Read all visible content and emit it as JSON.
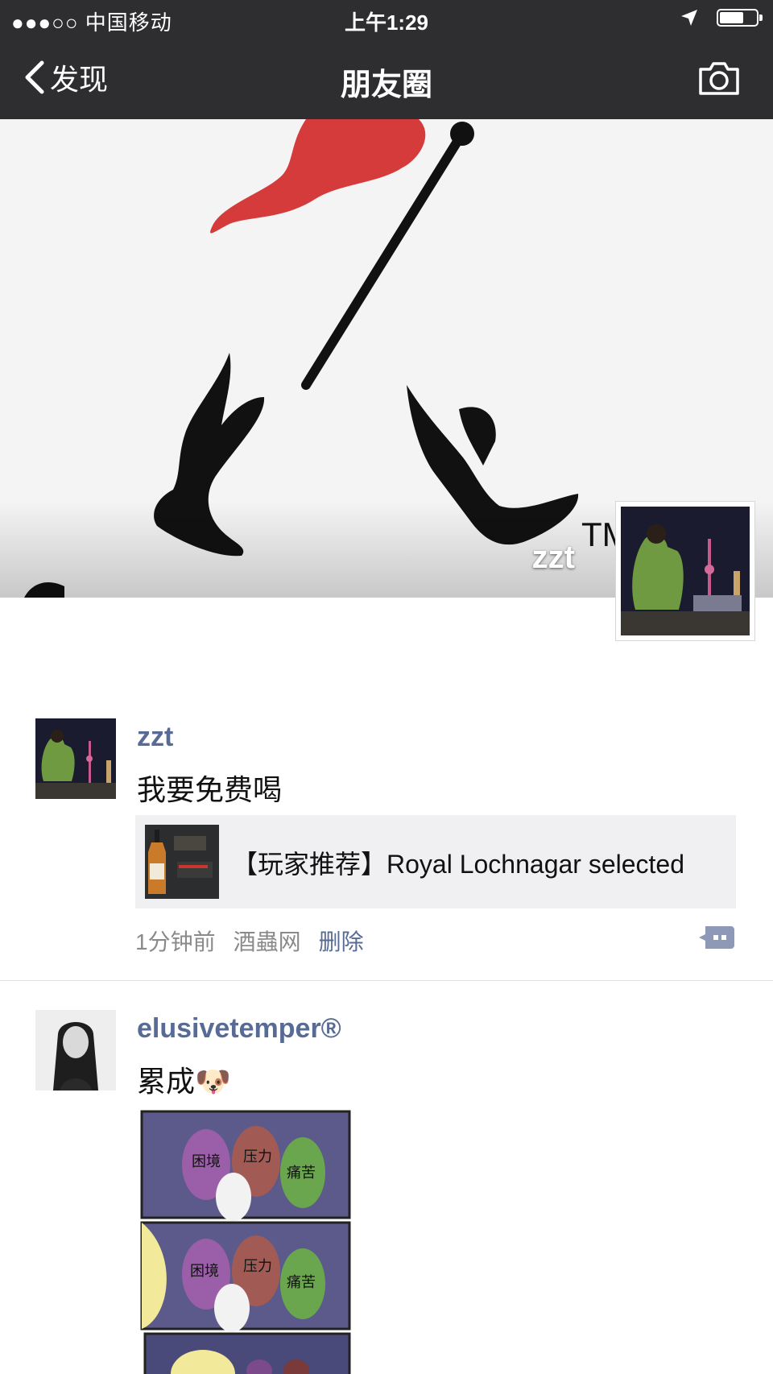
{
  "status_bar": {
    "carrier": "●●●○○ 中国移动",
    "time": "上午1:29"
  },
  "nav": {
    "back_label": "发现",
    "title": "朋友圈"
  },
  "cover": {
    "owner_name": "zzt"
  },
  "posts": [
    {
      "name": "zzt",
      "text": "我要免费喝",
      "link": {
        "title": "【玩家推荐】Royal Lochnagar selected"
      },
      "time": "1分钟前",
      "source": "酒蟲网",
      "delete_label": "删除"
    },
    {
      "name": "elusivetemper®",
      "text": "累成🐶",
      "comic_labels": [
        "困境",
        "压力",
        "痛苦",
        "困境",
        "压力",
        "痛苦"
      ]
    }
  ],
  "colors": {
    "nav_bg": "#2e2e30",
    "name_link": "#576b95",
    "card_bg": "#f0f0f2",
    "meta_gray": "#8a8a8a"
  }
}
